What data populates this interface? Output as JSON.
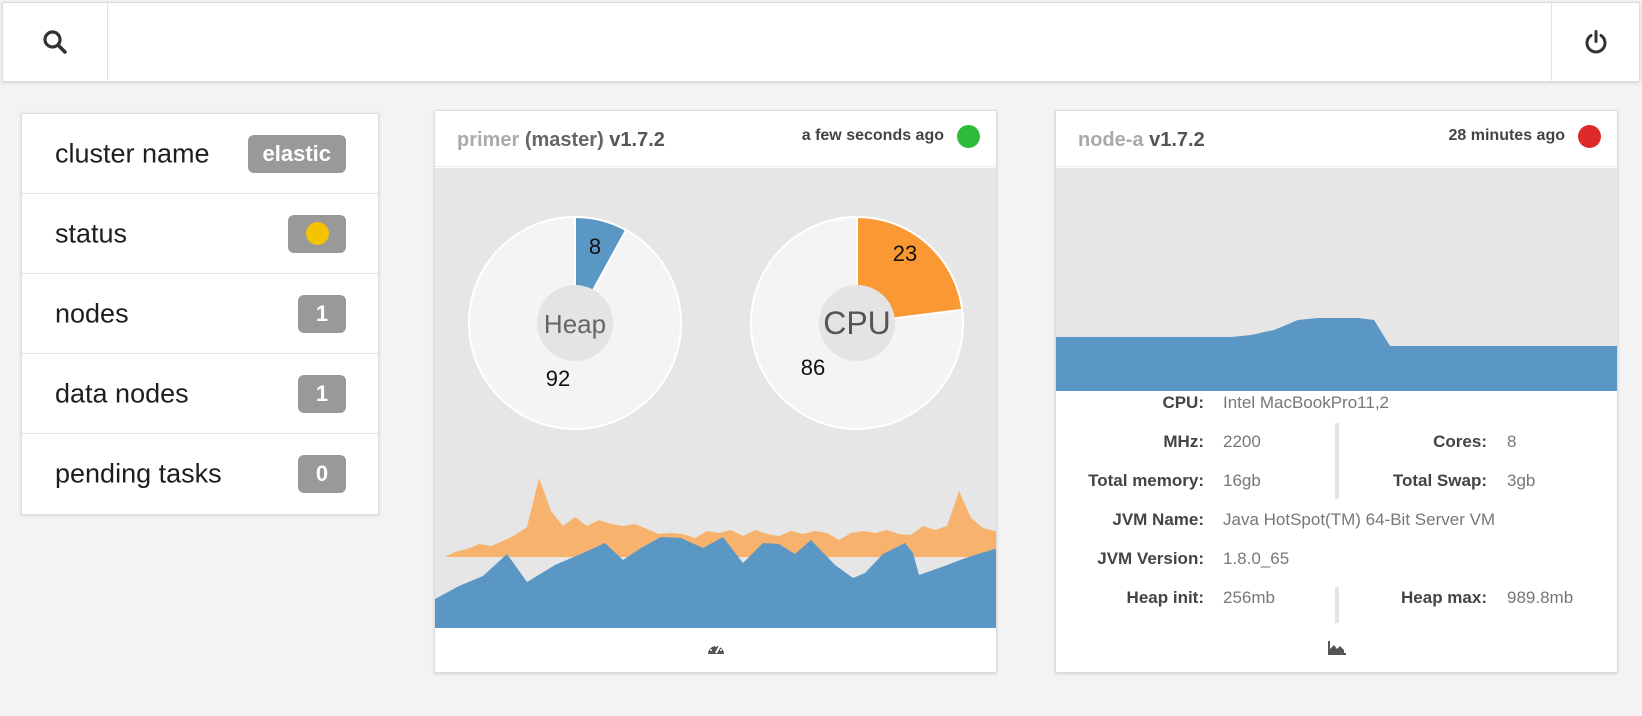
{
  "header": {
    "search_icon": "search-icon",
    "search_placeholder": "",
    "power_icon": "power-icon"
  },
  "cluster": {
    "rows": [
      {
        "label": "cluster name",
        "value": "elastic"
      },
      {
        "label": "status",
        "value": "",
        "status_color": "#f5c400"
      },
      {
        "label": "nodes",
        "value": "1"
      },
      {
        "label": "data nodes",
        "value": "1"
      },
      {
        "label": "pending tasks",
        "value": "0"
      }
    ]
  },
  "nodes": [
    {
      "name": "primer",
      "role": "(master)",
      "version": "v1.7.2",
      "updated": "a few seconds ago",
      "state_color": "#2fbb3a",
      "gauges": [
        {
          "label": "Heap",
          "used": 8,
          "free": 92,
          "color": "#5b97c5"
        },
        {
          "label": "CPU",
          "used": 23,
          "free": 86,
          "color": "#fa9933"
        }
      ],
      "footer_icon": "dashboard-icon"
    },
    {
      "name": "node-a",
      "role": "",
      "version": "v1.7.2",
      "updated": "28 minutes ago",
      "state_color": "#df2a2a",
      "info": {
        "cpu_label": "CPU:",
        "cpu": "Intel MacBookPro11,2",
        "mhz_label": "MHz:",
        "mhz": "2200",
        "cores_label": "Cores:",
        "cores": "8",
        "mem_label": "Total memory:",
        "mem": "16gb",
        "swap_label": "Total Swap:",
        "swap": "3gb",
        "jvm_name_label": "JVM Name:",
        "jvm_name": "Java HotSpot(TM) 64-Bit Server VM",
        "jvm_version_label": "JVM Version:",
        "jvm_version": "1.8.0_65",
        "heap_init_label": "Heap init:",
        "heap_init": "256mb",
        "heap_max_label": "Heap max:",
        "heap_max": "989.8mb"
      },
      "footer_icon": "area-chart-icon"
    }
  ],
  "colors": {
    "blue": "#5b97c5",
    "orange": "#f7b36e",
    "badge": "#999999"
  }
}
